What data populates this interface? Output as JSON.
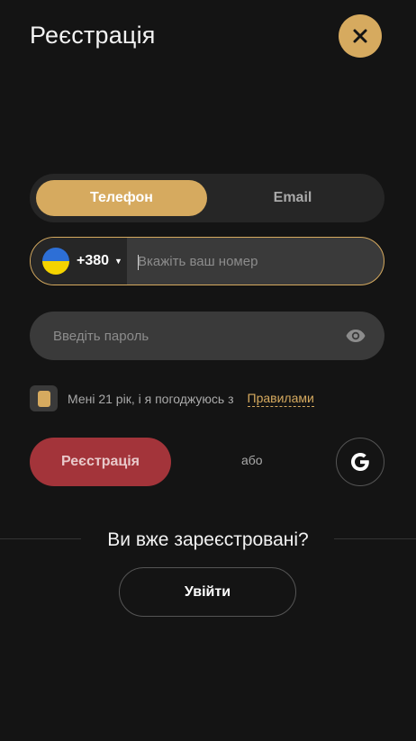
{
  "header": {
    "title": "Реєстрація",
    "close_icon": "close-icon"
  },
  "tabs": [
    {
      "label": "Телефон",
      "active": true
    },
    {
      "label": "Email",
      "active": false
    }
  ],
  "phone": {
    "flag_icon": "ukraine-flag-icon",
    "code": "+380",
    "caret": "▼",
    "placeholder": "Вкажіть ваш номер",
    "value": ""
  },
  "password": {
    "placeholder": "Введіть пароль",
    "value": "",
    "toggle_icon": "eye-icon"
  },
  "agreement": {
    "checked": true,
    "text": "Мені 21 рік, і я погоджуюсь з",
    "link_label": "Правилами"
  },
  "actions": {
    "register_label": "Реєстрація",
    "or_label": "або",
    "google_icon": "google-icon"
  },
  "login_prompt": {
    "question": "Ви вже зареєстровані?",
    "login_label": "Увійти"
  },
  "colors": {
    "background": "#141414",
    "accent_gold": "#d6aa5f",
    "register_red": "#a3343a",
    "field_bg": "#3a3a3a"
  }
}
